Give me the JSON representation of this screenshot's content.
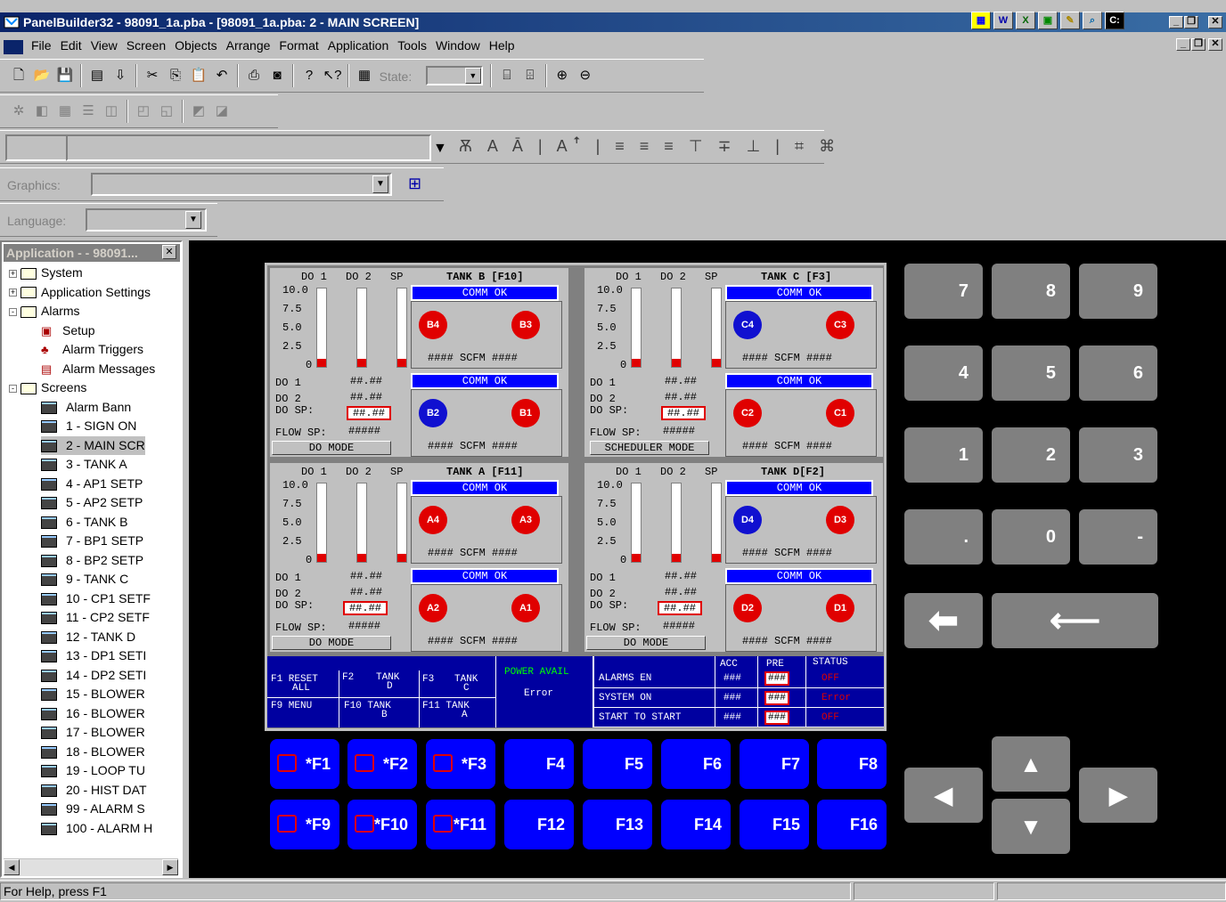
{
  "window": {
    "title": "PanelBuilder32 - 98091_1a.pba - [98091_1a.pba: 2 - MAIN SCREEN]"
  },
  "menu": [
    "File",
    "Edit",
    "View",
    "Screen",
    "Objects",
    "Arrange",
    "Format",
    "Application",
    "Tools",
    "Window",
    "Help"
  ],
  "toolbar": {
    "state_label": "State:",
    "graphics_label": "Graphics:",
    "language_label": "Language:"
  },
  "app_panel": {
    "title": "Application - - 98091...",
    "tree": [
      {
        "label": "System",
        "level": 0,
        "type": "folder",
        "exp": "+"
      },
      {
        "label": "Application Settings",
        "level": 0,
        "type": "folder",
        "exp": "+"
      },
      {
        "label": "Alarms",
        "level": 0,
        "type": "folder",
        "exp": "-"
      },
      {
        "label": "Setup",
        "level": 1,
        "type": "setup"
      },
      {
        "label": "Alarm Triggers",
        "level": 1,
        "type": "trigger"
      },
      {
        "label": "Alarm Messages",
        "level": 1,
        "type": "msg"
      },
      {
        "label": "Screens",
        "level": 0,
        "type": "folder",
        "exp": "-"
      },
      {
        "label": "Alarm Bann",
        "level": 1,
        "type": "screen"
      },
      {
        "label": "1 - SIGN ON",
        "level": 1,
        "type": "screen"
      },
      {
        "label": "2 - MAIN SCR",
        "level": 1,
        "type": "screen",
        "selected": true
      },
      {
        "label": "3 - TANK A",
        "level": 1,
        "type": "screen"
      },
      {
        "label": "4 - AP1 SETP",
        "level": 1,
        "type": "screen"
      },
      {
        "label": "5 - AP2 SETP",
        "level": 1,
        "type": "screen"
      },
      {
        "label": "6 - TANK B",
        "level": 1,
        "type": "screen"
      },
      {
        "label": "7 - BP1 SETP",
        "level": 1,
        "type": "screen"
      },
      {
        "label": "8 - BP2 SETP",
        "level": 1,
        "type": "screen"
      },
      {
        "label": "9 - TANK C",
        "level": 1,
        "type": "screen"
      },
      {
        "label": "10 - CP1 SETF",
        "level": 1,
        "type": "screen"
      },
      {
        "label": "11 - CP2 SETF",
        "level": 1,
        "type": "screen"
      },
      {
        "label": "12 - TANK D",
        "level": 1,
        "type": "screen"
      },
      {
        "label": "13 - DP1 SETI",
        "level": 1,
        "type": "screen"
      },
      {
        "label": "14 - DP2 SETI",
        "level": 1,
        "type": "screen"
      },
      {
        "label": "15 - BLOWER",
        "level": 1,
        "type": "screen"
      },
      {
        "label": "16 - BLOWER",
        "level": 1,
        "type": "screen"
      },
      {
        "label": "17 - BLOWER",
        "level": 1,
        "type": "screen"
      },
      {
        "label": "18 - BLOWER",
        "level": 1,
        "type": "screen"
      },
      {
        "label": "19 - LOOP TU",
        "level": 1,
        "type": "screen"
      },
      {
        "label": "20 - HIST DAT",
        "level": 1,
        "type": "screen"
      },
      {
        "label": "99 - ALARM S",
        "level": 1,
        "type": "screen"
      },
      {
        "label": "100 - ALARM H",
        "level": 1,
        "type": "screen"
      }
    ]
  },
  "hmi": {
    "quads": [
      {
        "tank": "TANK B [F10]",
        "pumps": [
          {
            "id": "B4",
            "c": "red"
          },
          {
            "id": "B3",
            "c": "red"
          },
          {
            "id": "B2",
            "c": "blue"
          },
          {
            "id": "B1",
            "c": "red"
          }
        ],
        "mode": "DO MODE",
        "levels": [
          0.1,
          0.1,
          0.1
        ]
      },
      {
        "tank": "TANK C [F3]",
        "pumps": [
          {
            "id": "C4",
            "c": "blue"
          },
          {
            "id": "C3",
            "c": "red"
          },
          {
            "id": "C2",
            "c": "red"
          },
          {
            "id": "C1",
            "c": "red"
          }
        ],
        "mode": "SCHEDULER MODE",
        "levels": [
          0.1,
          0.1,
          0.1
        ]
      },
      {
        "tank": "TANK A [F11]",
        "pumps": [
          {
            "id": "A4",
            "c": "red"
          },
          {
            "id": "A3",
            "c": "red"
          },
          {
            "id": "A2",
            "c": "red"
          },
          {
            "id": "A1",
            "c": "red"
          }
        ],
        "mode": "DO MODE",
        "levels": [
          0.1,
          0.1,
          0.1
        ]
      },
      {
        "tank": "TANK D[F2]",
        "pumps": [
          {
            "id": "D4",
            "c": "blue"
          },
          {
            "id": "D3",
            "c": "red"
          },
          {
            "id": "D2",
            "c": "red"
          },
          {
            "id": "D1",
            "c": "red"
          }
        ],
        "mode": "DO MODE",
        "levels": [
          0.1,
          0.1,
          0.1
        ]
      }
    ],
    "hdr": {
      "do1": "DO 1",
      "do2": "DO 2",
      "sp": "SP"
    },
    "scale": [
      "10.0",
      "7.5",
      "5.0",
      "2.5",
      "0"
    ],
    "comm": "COMM OK",
    "scfm": "#### SCFM ####",
    "do1_lbl": "DO 1",
    "do2_lbl": "DO 2",
    "dosp_lbl": "DO SP:",
    "flow_lbl": "FLOW SP:",
    "val": "##.##",
    "flow_val": "#####",
    "bottom": {
      "f1": "F1 RESET",
      "f1b": "ALL",
      "f2": "F2",
      "f2b": "TANK",
      "f2c": "D",
      "f3": "F3",
      "f3b": "TANK",
      "f3c": "C",
      "f9": "F9 MENU",
      "f10": "F10 TANK",
      "f10b": "B",
      "f11": "F11 TANK",
      "f11b": "A",
      "power": "POWER AVAIL",
      "error": "Error",
      "acc": "ACC",
      "pre": "PRE",
      "status": "STATUS",
      "rows": [
        {
          "label": "ALARMS EN",
          "acc": "###",
          "pre": "###",
          "status": "OFF"
        },
        {
          "label": "SYSTEM ON",
          "acc": "###",
          "pre": "###",
          "status": "Error"
        },
        {
          "label": "START TO START",
          "acc": "###",
          "pre": "###",
          "status": "OFF"
        }
      ]
    }
  },
  "keypad": [
    "7",
    "8",
    "9",
    "4",
    "5",
    "6",
    "1",
    "2",
    "3",
    ".",
    "0",
    "-"
  ],
  "fkeys_top": [
    "*F1",
    "*F2",
    "*F3",
    "F4",
    "F5",
    "F6",
    "F7",
    "F8"
  ],
  "fkeys_bottom": [
    "*F9",
    "*F10",
    "*F11",
    "F12",
    "F13",
    "F14",
    "F15",
    "F16"
  ],
  "status": {
    "help": "For Help, press F1"
  }
}
